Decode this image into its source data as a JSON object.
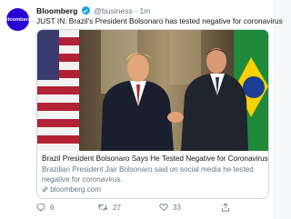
{
  "account": {
    "avatar_text": "Bloomberg",
    "avatar_color": "#2800d7",
    "name": "Bloomberg",
    "handle": "@business",
    "separator": "·",
    "time": "1m"
  },
  "tweet": {
    "text": "JUST IN: Brazil's President Bolsonaro has tested negative for coronavirus"
  },
  "card": {
    "title": "Brazil President Bolsonaro Says He Tested Negative for Coronavirus",
    "description": "Brazilian President Jair Bolsonaro said on social media he tested negative for coronavirus.",
    "domain": "bloomberg.com"
  },
  "actions": {
    "replies": "6",
    "retweets": "27",
    "likes": "33"
  },
  "colors": {
    "accent": "#1da1f2",
    "text": "#14171a",
    "muted": "#657786"
  }
}
